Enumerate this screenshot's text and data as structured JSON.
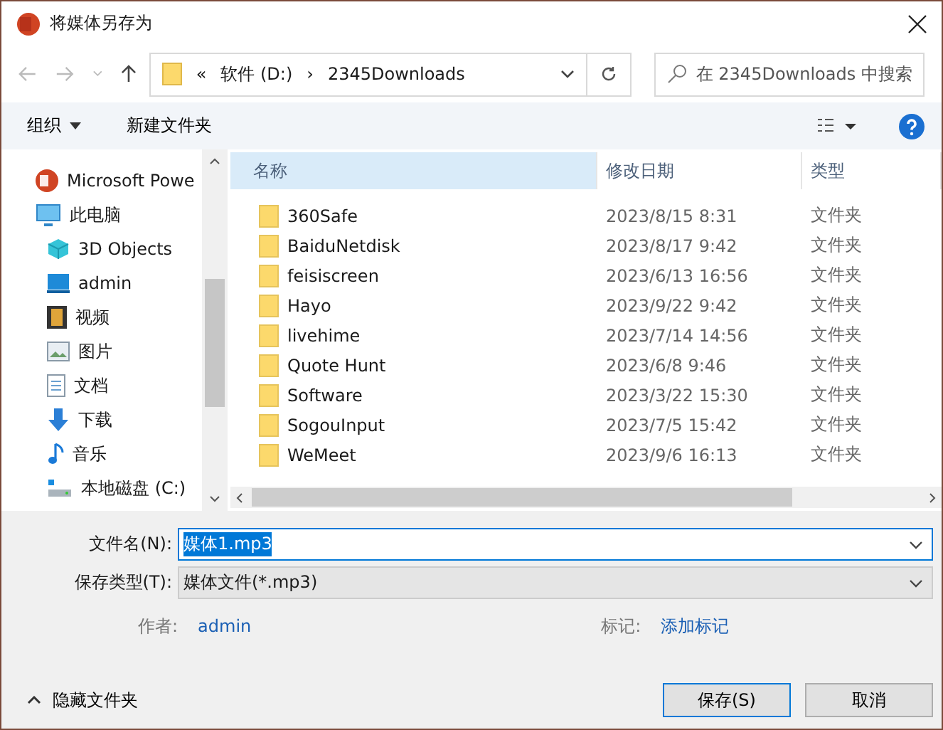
{
  "window": {
    "title": "将媒体另存为"
  },
  "address": {
    "crumbs": [
      "«",
      "软件 (D:)",
      "›",
      "2345Downloads"
    ]
  },
  "search": {
    "placeholder": "在 2345Downloads 中搜索"
  },
  "toolbar": {
    "organize": "组织",
    "new_folder": "新建文件夹"
  },
  "nav": [
    {
      "label": "Microsoft Powe",
      "kind": "ppt"
    },
    {
      "label": "此电脑",
      "kind": "pc",
      "children": [
        {
          "label": "3D Objects",
          "kind": "cube"
        },
        {
          "label": "admin",
          "kind": "desktop"
        },
        {
          "label": "视频",
          "kind": "video"
        },
        {
          "label": "图片",
          "kind": "picture"
        },
        {
          "label": "文档",
          "kind": "doc"
        },
        {
          "label": "下载",
          "kind": "download"
        },
        {
          "label": "音乐",
          "kind": "music"
        },
        {
          "label": "本地磁盘 (C:)",
          "kind": "drive"
        }
      ]
    }
  ],
  "table": {
    "columns": [
      {
        "label": "名称",
        "sorted": true
      },
      {
        "label": "修改日期",
        "sorted": false
      },
      {
        "label": "类型",
        "sorted": false
      }
    ],
    "rows": [
      [
        "360Safe",
        "2023/8/15 8:31",
        "文件夹"
      ],
      [
        "BaiduNetdisk",
        "2023/8/17 9:42",
        "文件夹"
      ],
      [
        "feisiscreen",
        "2023/6/13 16:56",
        "文件夹"
      ],
      [
        "Hayo",
        "2023/9/22 9:42",
        "文件夹"
      ],
      [
        "livehime",
        "2023/7/14 14:56",
        "文件夹"
      ],
      [
        "Quote Hunt",
        "2023/6/8 9:46",
        "文件夹"
      ],
      [
        "Software",
        "2023/3/22 15:30",
        "文件夹"
      ],
      [
        "SogouInput",
        "2023/7/5 15:42",
        "文件夹"
      ],
      [
        "WeMeet",
        "2023/9/6 16:13",
        "文件夹"
      ]
    ]
  },
  "file_name": {
    "label": "文件名(N):",
    "value": "媒体1.mp3",
    "text_selected": true
  },
  "save_type": {
    "label": "保存类型(T):",
    "value": "媒体文件(*.mp3)"
  },
  "meta": [
    {
      "label": "作者:",
      "value": "admin"
    },
    {
      "label": "标记:",
      "value": "添加标记"
    }
  ],
  "hide_folders": "隐藏文件夹",
  "buttons": [
    "保存(S)",
    "取消"
  ]
}
